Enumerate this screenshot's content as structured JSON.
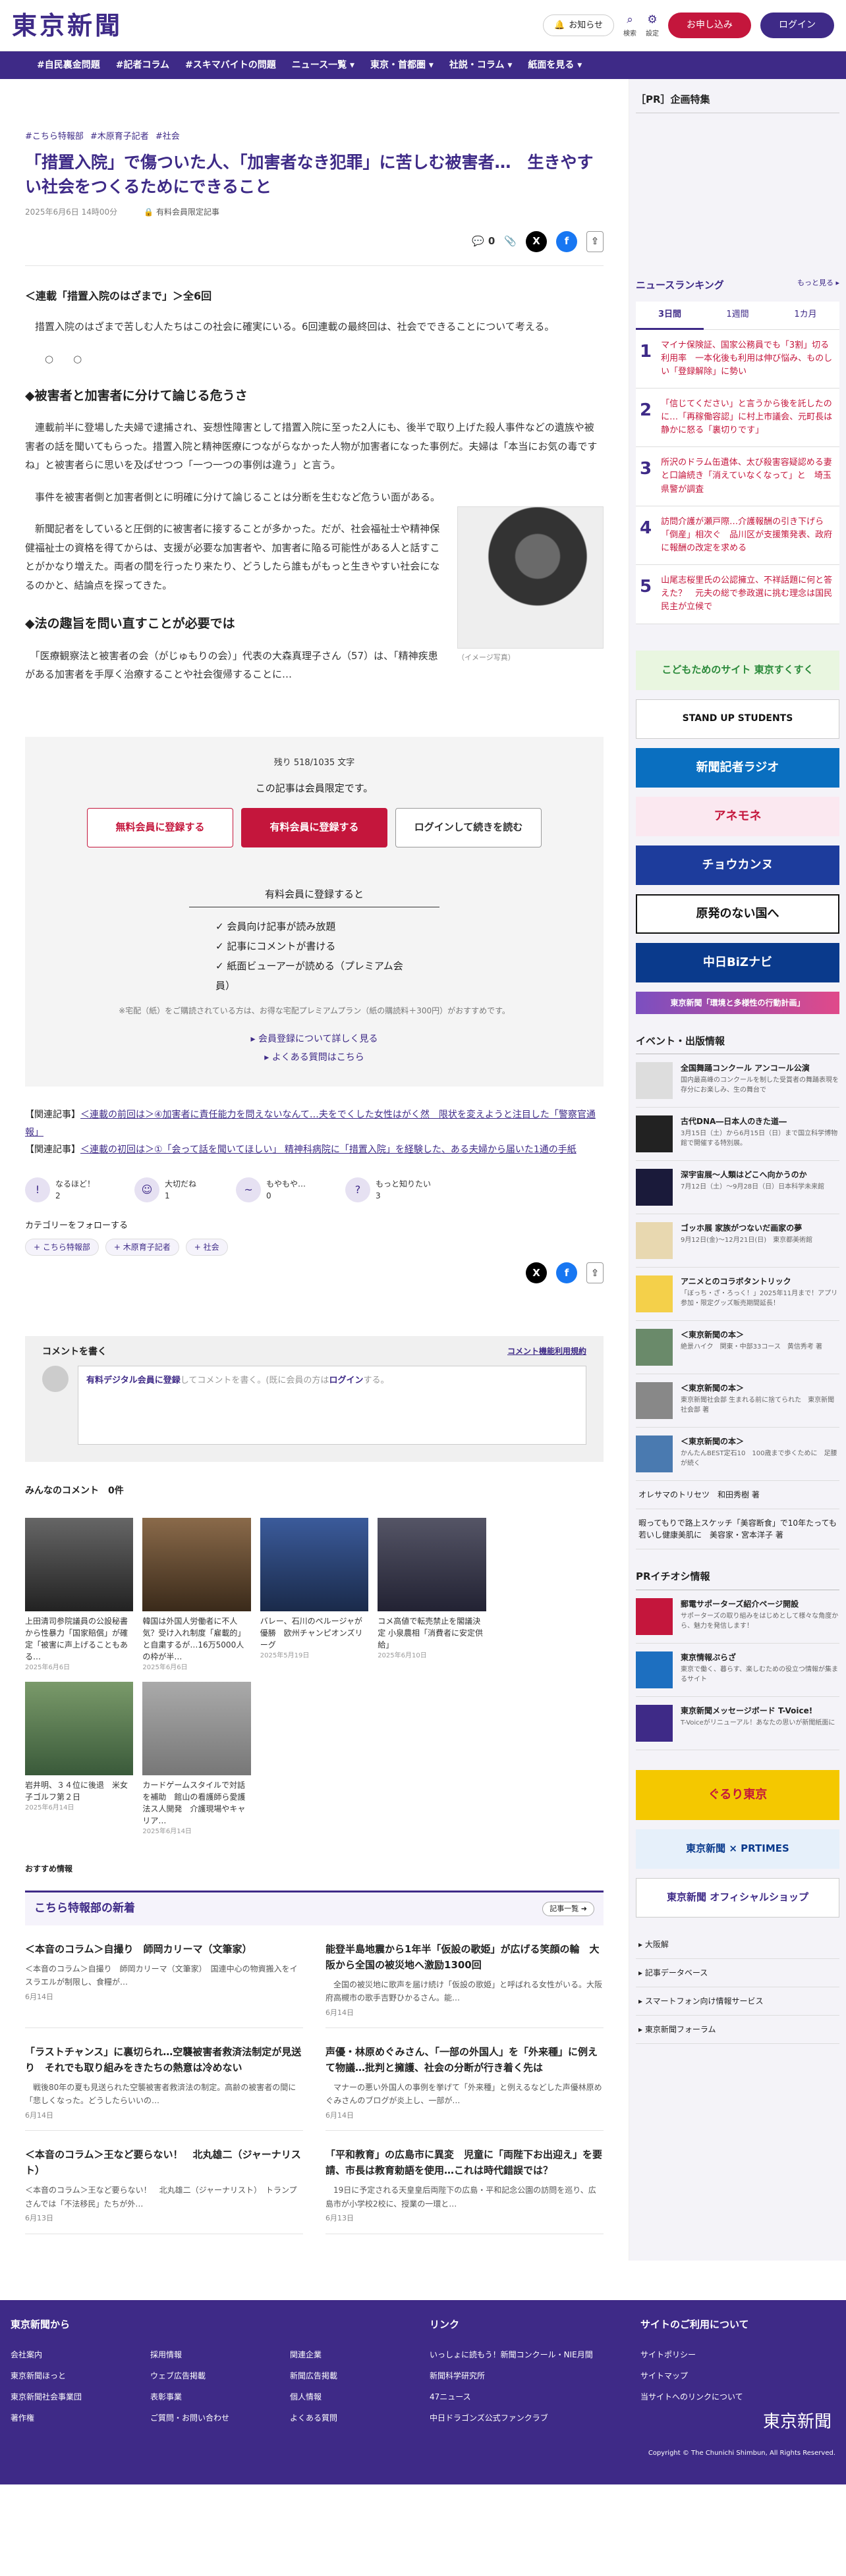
{
  "header": {
    "logo": "東京新聞",
    "notify": "お知らせ",
    "search": "検索",
    "settings": "設定",
    "signup": "お申し込み",
    "login": "ログイン"
  },
  "nav": [
    "#自民裏金問題",
    "#記者コラム",
    "#スキマバイトの問題",
    "ニュース一覧 ▾",
    "東京・首都圏 ▾",
    "社説・コラム ▾",
    "紙面を見る ▾"
  ],
  "article": {
    "tags": [
      "#こちら特報部",
      "#木原育子記者",
      "#社会"
    ],
    "title": "「措置入院」で傷ついた人、「加害者なき犯罪」に苦しむ被害者…　生きやすい社会をつくるためにできること",
    "date": "2025年6月6日 14時00分",
    "member_only": "有料会員限定記事",
    "comment_count": "0",
    "series": "＜連載「措置入院のはざまで」＞全6回",
    "p1": "　措置入院のはざまで苦しむ人たちはこの社会に確実にいる。6回連載の最終回は、社会でできることについて考える。",
    "dots": "○○",
    "h1": "◆被害者と加害者に分けて論じる危うさ",
    "p2": "　連載前半に登場した夫婦で逮捕され、妄想性障害として措置入院に至った2人にも、後半で取り上げた殺人事件などの遺族や被害者の話を聞いてもらった。措置入院と精神医療につながらなかった人物が加害者になった事例だ。夫婦は「本当にお気の毒ですね」と被害者らに思いを及ばせつつ「一つ一つの事例は違う」と言う。",
    "p3": "　事件を被害者側と加害者側とに明確に分けて論じることは分断を生むなど危うい面がある。",
    "p4": "　新聞記者をしていると圧倒的に被害者に接することが多かった。だが、社会福祉士や精神保健福祉士の資格を得てからは、支援が必要な加害者や、加害者に陥る可能性がある人と話すことがかなり増えた。両者の間を行ったり来たり、どうしたら誰もがもっと生きやすい社会になるのかと、結論点を探ってきた。",
    "h2": "◆法の趣旨を問い直すことが必要では",
    "p5": "　「医療観察法と被害者の会（がじゅもりの会）」代表の大森真理子さん（57）は、「精神疾患がある加害者を手厚く治療することや社会復帰することに…",
    "caption": "（イメージ写真）"
  },
  "paywall": {
    "remain": "残り 518/1035 文字",
    "limited": "この記事は会員限定です。",
    "free": "無料会員に登録する",
    "paid": "有料会員に登録する",
    "login": "ログインして続きを読む",
    "sub": "有料会員に登録すると",
    "b1": "✓ 会員向け記事が読み放題",
    "b2": "✓ 記事にコメントが書ける",
    "b3": "✓ 紙面ビューアーが読める（プレミアム会員）",
    "note": "※宅配（紙）をご購読されている方は、お得な宅配プレミアムプラン（紙の購読料＋300円）がおすすめです。",
    "l1": "▸ 会員登録について詳しく見る",
    "l2": "▸ よくある質問はこちら"
  },
  "related": {
    "r1_label": "【関連記事】",
    "r1": "＜連載の前回は＞④加害者に責任能力を問えないなんて…夫をでくした女性はがく然　限状を変えようと注目した「警察官通報」",
    "r2_label": "【関連記事】",
    "r2": "＜連載の初回は＞①「会って話を聞いてほしい」 精神科病院に「措置入院」を経験した、ある夫婦から届いた1通の手紙"
  },
  "reactions": [
    {
      "icon": "!",
      "label": "なるほど！",
      "n": "2"
    },
    {
      "icon": "☺",
      "label": "大切だね",
      "n": "1"
    },
    {
      "icon": "~",
      "label": "もやもや…",
      "n": "0"
    },
    {
      "icon": "?",
      "label": "もっと知りたい",
      "n": "3"
    }
  ],
  "follow": {
    "label": "カテゴリーをフォローする",
    "tags": [
      "+ こちら特報部",
      "+ 木原育子記者",
      "+ 社会"
    ]
  },
  "comment": {
    "title": "コメントを書く",
    "rule": "コメント機能利用規約",
    "pre": "有料デジタル会員に登録",
    "mid": "してコメントを書く。(既に会員の方は",
    "login": "ログイン",
    "post": "する。"
  },
  "all_comments": "みんなのコメント　0件",
  "cards": [
    {
      "t": "上田清司参院議員の公設秘書から性暴力「国家賠償」が確定「被害に声上げることもある…",
      "d": "2025年6月6日"
    },
    {
      "t": "韓国は外国人労働者に不人気？受け入れ制度「雇載的」と自粛するが…16万5000人の枠が半…",
      "d": "2025年6月6日"
    },
    {
      "t": "バレー、石川のペルージャが優勝　欧州チャンピオンズリーグ",
      "d": "2025年5月19日"
    },
    {
      "t": "コメ高値で転売禁止を閣議決定 小泉農相「消費者に安定供給」",
      "d": "2025年6月10日"
    },
    {
      "t": "岩井明、３４位に後退　米女子ゴルフ第２日",
      "d": "2025年6月14日"
    },
    {
      "t": "カードゲームスタイルで対話を補助　館山の看護師ら愛護法ス人開発　介護現場やキャリア…",
      "d": "2025年6月14日"
    }
  ],
  "recommend": "おすすめ情報",
  "special": {
    "title": "こちら特報部の新着",
    "more": "記事一覧 ➜",
    "items": [
      {
        "h": "＜本音のコラム＞自撮り　師岡カリーマ（文筆家）",
        "e": "＜本音のコラム＞自撮り　師岡カリーマ（文筆家）　国連中心の物資搬入をイスラエルが制限し、食糧が…",
        "d": "6月14日"
      },
      {
        "h": "能登半島地震から1年半「仮設の歌姫」が広げる笑顔の輪　大阪から全国の被災地へ激励1300回",
        "e": "　全国の被災地に歌声を届け続け「仮設の歌姫」と呼ばれる女性がいる。大阪府高槻市の歌手吉野ひかるさん。能…",
        "d": "6月14日"
      },
      {
        "h": "「ラストチャンス」に裏切られ…空襲被害者救済法制定が見送り　それでも取り組みをきたちの熱意は冷めない",
        "e": "　戦後80年の夏も見送られた空襲被害者救済法の制定。高齢の被害者の間に「悲しくなった。どうしたらいいの…",
        "d": "6月14日"
      },
      {
        "h": "声優・林原めぐみさん、「一部の外国人」を「外来種」に例えて物議…批判と擁護、社会の分断が行き着く先は",
        "e": "　マナーの悪い外国人の事例を挙げて「外来種」と例えるなどした声優林原めぐみさんのブログが炎上し、一部が…",
        "d": "6月14日"
      },
      {
        "h": "＜本音のコラム＞王など要らない！　北丸雄二（ジャーナリスト）",
        "e": "＜本音のコラム＞王など要らない！　北丸雄二（ジャーナリスト）　トランプさんでは「不法移民」たちが外…",
        "d": "6月13日"
      },
      {
        "h": "「平和教育」の広島市に異変　児童に「両陛下お出迎え」を要請、市長は教育勅語を使用…これは時代錯誤では？",
        "e": "　19日に予定される天皇皇后両陛下の広島・平和記念公園の訪問を巡り、広島市が小学校2校に、授業の一環と…",
        "d": "6月13日"
      }
    ]
  },
  "side": {
    "pr": "［PR］企画特集",
    "ranking": "ニュースランキング",
    "more": "もっと見る ▸",
    "tabs": [
      "3日間",
      "1週間",
      "1カ月"
    ],
    "ranks": [
      "マイナ保険証、国家公務員でも「3割」切る利用率　一本化後も利用は伸び悩み、ものしい「登録解除」に勢い",
      "「信じてください」と言うから後を託したのに…「再稼働容認」に村上市議会、元町長は静かに怒る「裏切りです」",
      "所沢のドラム缶遺体、太び殺害容疑認める妻と口論続き「消えていなくなって」と　埼玉県警が調査",
      "訪問介護が瀬戸際…介護報酬の引き下げら「倒産」相次ぐ　品川区が支援策発表、政府に報酬の改定を求める",
      "山尾志桜里氏の公認擁立、不祥話題に何と答えた？　元夫の総で参政選に挑む理念は国民民主が立候で"
    ],
    "banners": [
      "こどもためのサイト 東京すくすく",
      "STAND UP STUDENTS",
      "新聞記者ラジオ",
      "アネモネ",
      "チョウカンヌ",
      "原発のない国へ",
      "中日BiZナビ",
      "東京新聞「環境と多様性の行動計画」"
    ],
    "events_h": "イベント・出版情報",
    "events": [
      {
        "t": "全国舞踊コンクール アンコール公演",
        "d": "国内最高峰のコンクールを制した受賞者の舞踊表現を存分にお楽しみ、生の舞台で"
      },
      {
        "t": "古代DNA―日本人のきた道―",
        "d": "3月15日（土）から6月15日（日）まで国立科学博物館で開催する特別展。"
      },
      {
        "t": "深宇宙展〜人類はどこへ向かうのか",
        "d": "7月12日（土）〜9月28日（日）日本科学未来館"
      },
      {
        "t": "ゴッホ展 家族がつないだ画家の夢",
        "d": "9月12日(金)〜12月21日(日)　東京都美術館"
      },
      {
        "t": "アニメとのコラボタントリック",
        "d": "「ぼっち・ざ・ろっく！」2025年11月まで！アプリ参加・限定グッズ販売期間延長！"
      },
      {
        "t": "＜東京新聞の本＞",
        "d": "絶景ハイク　関東・中部33コース　黄信秀考 著"
      },
      {
        "t": "＜東京新聞の本＞",
        "d": "東京新聞社会部 生まれる前に捨てられた　東京新聞社会部 著"
      },
      {
        "t": "＜東京新聞の本＞",
        "d": "かんたんBEST定石10　100歳まで歩くために　足腰が続く"
      }
    ],
    "links": [
      "オレサマのトリセツ　和田秀樹 著",
      "暇ってもりで路上スケッチ「美容断食」で10年たっても若いし健康美肌に　美容家・宮本洋子 著"
    ],
    "pr_info": "PRイチオシ情報",
    "pri": [
      {
        "t": "郵電サポーターズ紹介ページ開設",
        "d": "サポーターズの取り組みをはじめとして様々な角度から、魅力を発信します！"
      },
      {
        "t": "東京情報ぷらざ",
        "d": "東京で働く、暮らす、楽しむための役立つ情報が集まるサイト"
      },
      {
        "t": "東京新聞メッセージボード T-Voice!",
        "d": "T-Voiceがリニューアル！あなたの思いが新聞紙面に"
      }
    ],
    "banners2": [
      "ぐるり東京",
      "東京新聞 × PRTIMES",
      "東京新聞 オフィシャルショップ"
    ],
    "slinks": [
      "▸ 大阪解",
      "▸ 記事データベース",
      "▸ スマートフォン向け情報サービス",
      "▸ 東京新聞フォーラム"
    ]
  },
  "footer": {
    "c1": "東京新聞から",
    "c1l": [
      "会社案内",
      "採用情報",
      "関連企業",
      "東京新聞ほっと",
      "ウェブ広告掲載",
      "新聞広告掲載",
      "東京新聞社会事業団",
      "表彰事業",
      "個人情報",
      "著作権",
      "ご質問・お問い合わせ",
      "よくある質問"
    ],
    "c2": "リンク",
    "c2l": [
      "いっしょに読もう！新聞コンクール・NIE月間",
      "新聞科学研究所",
      "47ニュース",
      "中日ドラゴンズ公式ファンクラブ"
    ],
    "c3": "サイトのご利用について",
    "c3l": [
      "サイトポリシー",
      "サイトマップ",
      "当サイトへのリンクについて"
    ],
    "copy": "Copyright © The Chunichi Shimbun, All Rights Reserved."
  }
}
